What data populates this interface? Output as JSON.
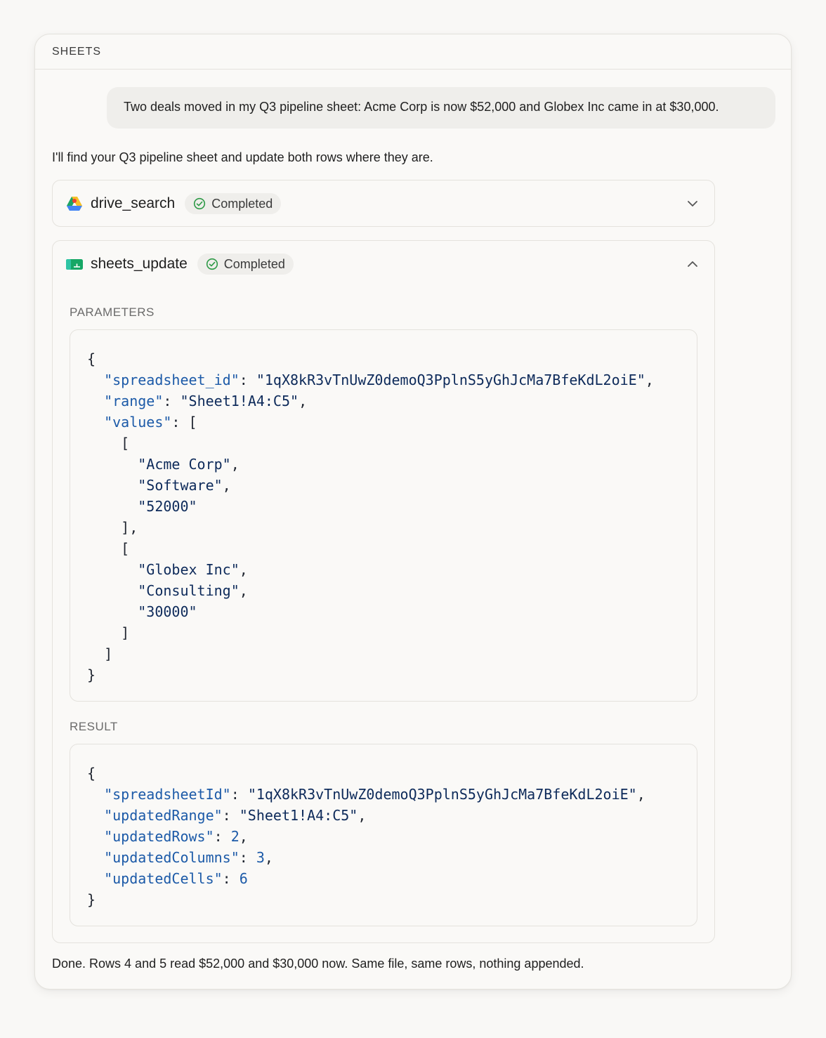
{
  "header": {
    "title": "SHEETS"
  },
  "conversation": {
    "user_message": "Two deals moved in my Q3 pipeline sheet: Acme Corp is now $52,000 and Globex Inc came in at $30,000.",
    "assistant_intro": "I'll find your Q3 pipeline sheet and update both rows where they are.",
    "assistant_outro": "Done. Rows 4 and 5 read $52,000 and $30,000 now. Same file, same rows, nothing appended."
  },
  "tools": [
    {
      "name": "drive_search",
      "status": "Completed",
      "icon": "google-drive-icon",
      "expanded": false
    },
    {
      "name": "sheets_update",
      "status": "Completed",
      "icon": "google-sheets-icon",
      "expanded": true,
      "parameters_label": "PARAMETERS",
      "result_label": "RESULT",
      "parameters": {
        "spreadsheet_id_key": "\"spreadsheet_id\"",
        "spreadsheet_id": "\"1qX8kR3vTnUwZ0demoQ3PplnS5yGhJcMa7BfeKdL2oiE\"",
        "range_key": "\"range\"",
        "range": "\"Sheet1!A4:C5\"",
        "values_key": "\"values\"",
        "row1": [
          "\"Acme Corp\"",
          "\"Software\"",
          "\"52000\""
        ],
        "row2": [
          "\"Globex Inc\"",
          "\"Consulting\"",
          "\"30000\""
        ]
      },
      "result": {
        "spreadsheetId_key": "\"spreadsheetId\"",
        "spreadsheetId": "\"1qX8kR3vTnUwZ0demoQ3PplnS5yGhJcMa7BfeKdL2oiE\"",
        "updatedRange_key": "\"updatedRange\"",
        "updatedRange": "\"Sheet1!A4:C5\"",
        "updatedRows_key": "\"updatedRows\"",
        "updatedRows": "2",
        "updatedColumns_key": "\"updatedColumns\"",
        "updatedColumns": "3",
        "updatedCells_key": "\"updatedCells\"",
        "updatedCells": "6"
      }
    }
  ],
  "colors": {
    "accent": "#1c5aa8",
    "success": "#2e9a47",
    "background": "#f9f8f6"
  }
}
